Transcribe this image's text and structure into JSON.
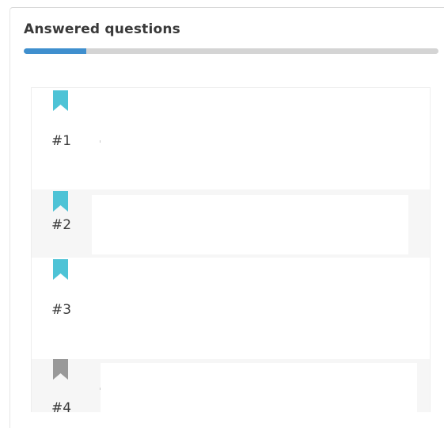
{
  "section": {
    "title": "Answered questions",
    "progress_fraction": 0.15
  },
  "colors": {
    "accent": "#3f8fce",
    "bookmark_answered": "#4ec3d6",
    "bookmark_unanswered": "#999999"
  },
  "questions": [
    {
      "number": "#1",
      "bookmark_icon": "bookmark-icon",
      "state": "answered"
    },
    {
      "number": "#2",
      "bookmark_icon": "bookmark-icon",
      "state": "answered"
    },
    {
      "number": "#3",
      "bookmark_icon": "bookmark-icon",
      "state": "answered"
    },
    {
      "number": "#4",
      "bookmark_icon": "bookmark-icon",
      "state": "unanswered"
    }
  ]
}
